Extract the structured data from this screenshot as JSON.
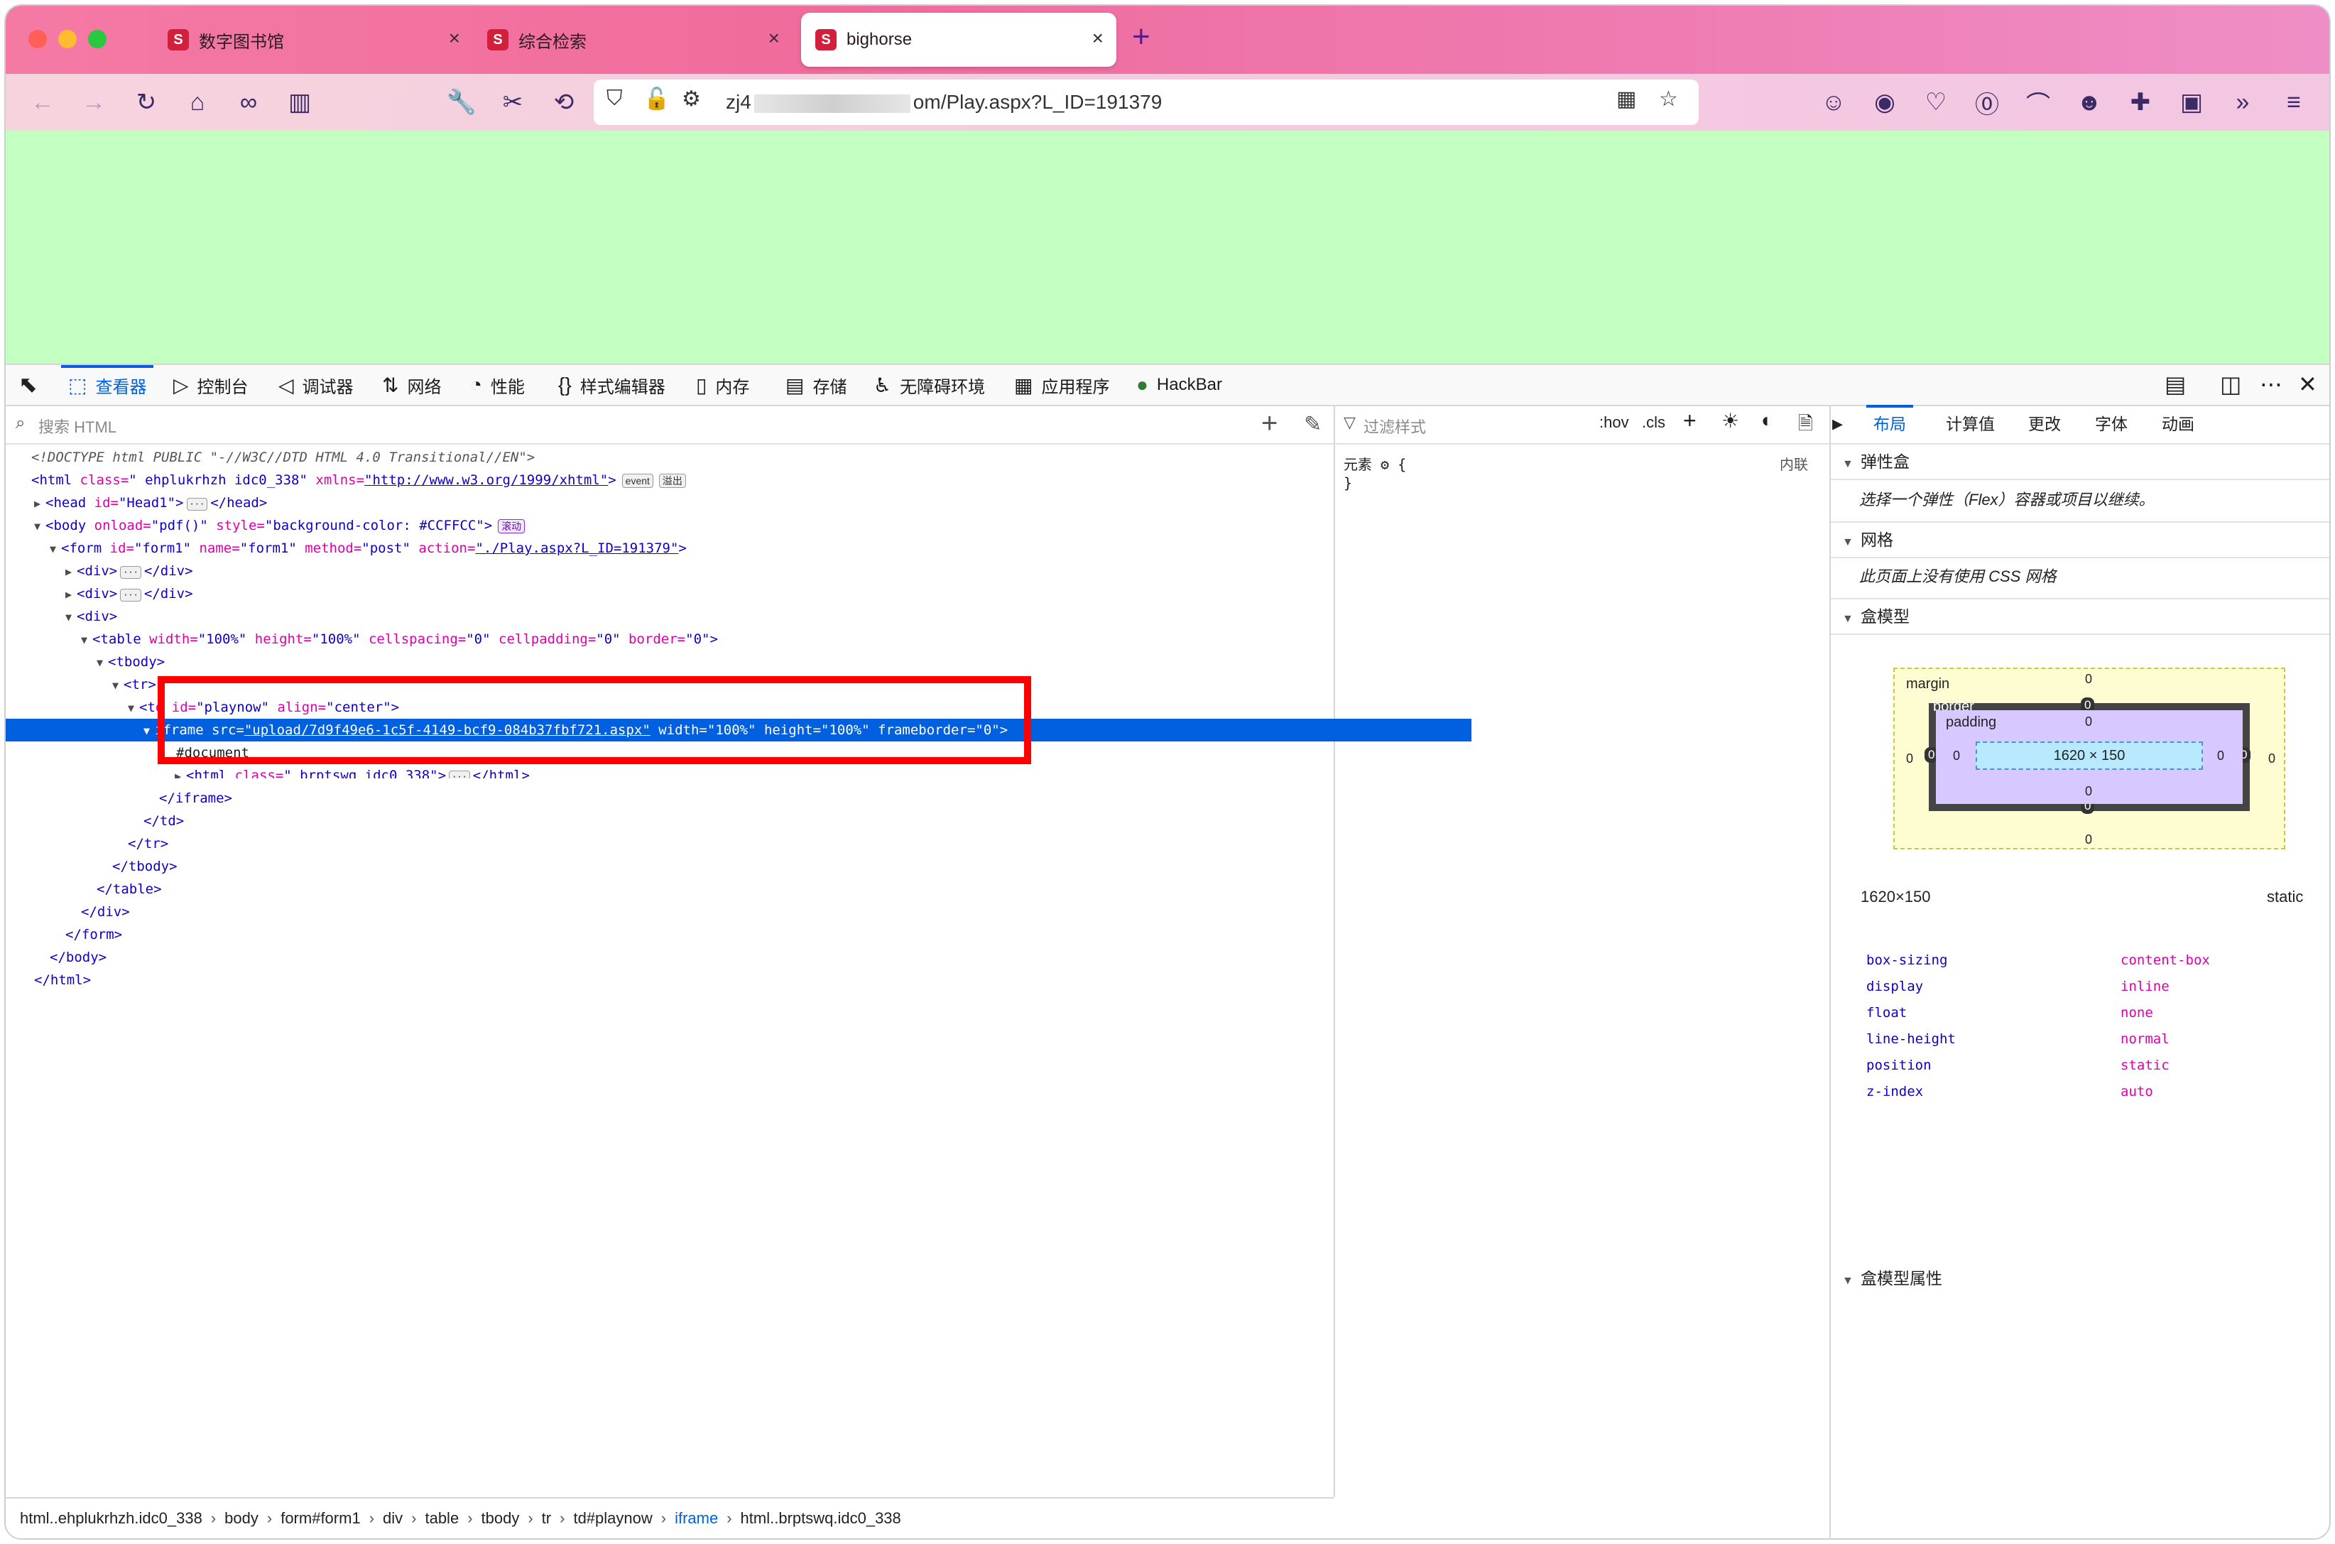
{
  "browser": {
    "tabs": [
      {
        "title": "数字图书馆",
        "active": false
      },
      {
        "title": "综合检索",
        "active": false
      },
      {
        "title": "bighorse",
        "active": true
      }
    ],
    "tab_close_glyph": "×",
    "new_tab_glyph": "+",
    "favicon_letter": "S",
    "url_prefix": "zj4",
    "url_suffix": "om/Play.aspx?L_ID=191379",
    "accent": "#0060df",
    "page_background": "#C2FFC0"
  },
  "devtools": {
    "tabs": [
      {
        "icon": "inspector-icon",
        "glyph": "⬚",
        "label": "查看器"
      },
      {
        "icon": "console-icon",
        "glyph": "▷",
        "label": "控制台"
      },
      {
        "icon": "debugger-icon",
        "glyph": "◁",
        "label": "调试器"
      },
      {
        "icon": "network-icon",
        "glyph": "⇅",
        "label": "网络"
      },
      {
        "icon": "performance-icon",
        "glyph": "◔",
        "label": "性能"
      },
      {
        "icon": "style-editor-icon",
        "glyph": "{}",
        "label": "样式编辑器"
      },
      {
        "icon": "memory-icon",
        "glyph": "▯",
        "label": "内存"
      },
      {
        "icon": "storage-icon",
        "glyph": "▤",
        "label": "存储"
      },
      {
        "icon": "accessibility-icon",
        "glyph": "♿",
        "label": "无障碍环境"
      },
      {
        "icon": "application-icon",
        "glyph": "▦",
        "label": "应用程序"
      },
      {
        "icon": "hackbar-icon",
        "glyph": "●",
        "label": "HackBar"
      }
    ],
    "search_placeholder": "搜索 HTML",
    "filter_placeholder": "过滤样式",
    "filter_hov": ":hov",
    "filter_cls": ".cls",
    "rule_selector": "元素 ⚙ {",
    "rule_close": "}",
    "rule_source": "内联",
    "html_tree": {
      "doctype": "<!DOCTYPE html PUBLIC \"-//W3C//DTD HTML 4.0 Transitional//EN\">",
      "html_open": {
        "tag": "<html",
        "a1": " class=",
        "v1": "\" ehplukrhzh idc0_338\"",
        "a2": " xmlns=",
        "v2": "\"http://www.w3.org/1999/xhtml\"",
        "end": ">",
        "badge1": "event",
        "badge2": "溢出"
      },
      "head": {
        "open": "<head",
        "a1": " id=",
        "v1": "\"Head1\"",
        "end": ">",
        "close": "</head>"
      },
      "body_open": {
        "tag": "<body",
        "a1": " onload=",
        "v1": "\"pdf()\"",
        "a2": " style=",
        "v2": "\"background-color: #CCFFCC\"",
        "end": ">",
        "badge": "滚动"
      },
      "form_open": {
        "tag": "<form",
        "a1": " id=",
        "v1": "\"form1\"",
        "a2": " name=",
        "v2": "\"form1\"",
        "a3": " method=",
        "v3": "\"post\"",
        "a4": " action=",
        "v4": "\"./Play.aspx?L_ID=191379\"",
        "end": ">"
      },
      "div_collapsed": "<div>",
      "div_close": "</div>",
      "div_open": "<div>",
      "table_open": {
        "tag": "<table",
        "a1": " width=",
        "v1": "\"100%\"",
        "a2": " height=",
        "v2": "\"100%\"",
        "a3": " cellspacing=",
        "v3": "\"0\"",
        "a4": " cellpadding=",
        "v4": "\"0\"",
        "a5": " border=",
        "v5": "\"0\"",
        "end": ">"
      },
      "tbody_open": "<tbody>",
      "tr_open": "<tr>",
      "td_open": {
        "tag": "<t",
        "a1": "d id=",
        "v1": "\"playnow\"",
        "a2": " align=",
        "v2": "\"center\"",
        "end": ">"
      },
      "iframe_open": {
        "tag": "iframe",
        "a1": " src=",
        "v1": "\"upload/7d9f49e6-1c5f-4149-bcf9-084b37fbf721.aspx\"",
        "a2": " width=",
        "v2": "\"100%\"",
        "a3": " height=",
        "v3": "\"100%\"",
        "a4": " frameborder=",
        "v4": "\"0\"",
        "end": ">"
      },
      "document_node": "#document",
      "inner_html": {
        "tag": "<html",
        "a1": " class=",
        "v1": "\" brptswq idc0_338\"",
        "end": ">",
        "close": "</html>"
      },
      "iframe_close": "</iframe>",
      "td_close": "</td>",
      "tr_close": "</tr>",
      "tbody_close": "</tbody>",
      "table_close": "</table>",
      "form_close": "</form>",
      "body_close": "</body>",
      "html_close": "</html>"
    },
    "breadcrumbs": [
      "html..ehplukrhzh.idc0_338",
      "body",
      "form#form1",
      "div",
      "table",
      "tbody",
      "tr",
      "td#playnow",
      "iframe",
      "html..brptswq.idc0_338"
    ],
    "breadcrumb_current_index": 8,
    "layout_tabs": [
      "布局",
      "计算值",
      "更改",
      "字体",
      "动画"
    ],
    "sections": {
      "flex": "弹性盒",
      "flex_note": "选择一个弹性（Flex）容器或项目以继续。",
      "grid": "网格",
      "grid_note": "此页面上没有使用 CSS 网格",
      "box_model": "盒模型",
      "box_props": "盒模型属性"
    },
    "box_model": {
      "margin_label": "margin",
      "border_label": "border",
      "padding_label": "padding",
      "content": "1620 × 150",
      "zero": "0"
    },
    "element_size": "1620×150",
    "element_position": "static",
    "box_properties": [
      {
        "name": "box-sizing",
        "value": "content-box"
      },
      {
        "name": "display",
        "value": "inline"
      },
      {
        "name": "float",
        "value": "none"
      },
      {
        "name": "line-height",
        "value": "normal"
      },
      {
        "name": "position",
        "value": "static"
      },
      {
        "name": "z-index",
        "value": "auto"
      }
    ]
  }
}
